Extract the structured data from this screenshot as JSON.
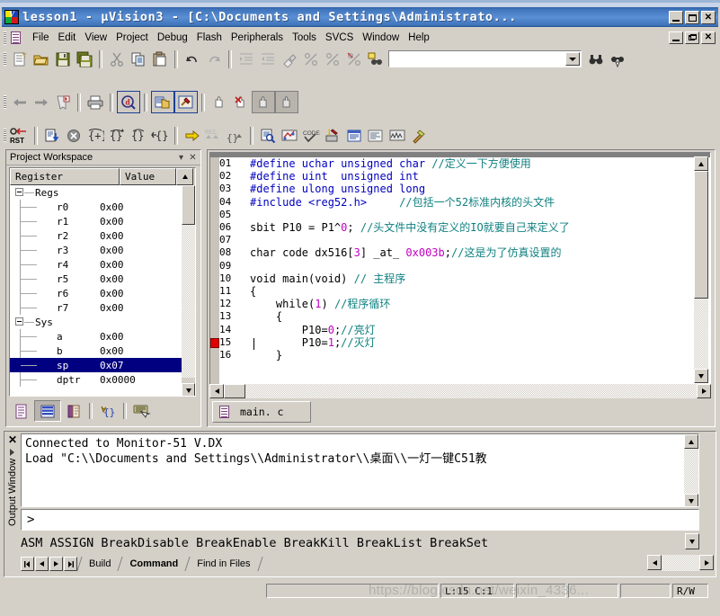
{
  "window": {
    "title": "lesson1  - µVision3 - [C:\\Documents and Settings\\Administrato...",
    "minimize": "–",
    "maximize": "□",
    "close": "✕"
  },
  "mdi": {
    "minimize": "–",
    "restore": "❐",
    "close": "✕"
  },
  "menu": {
    "items": [
      {
        "label": "File"
      },
      {
        "label": "Edit"
      },
      {
        "label": "View"
      },
      {
        "label": "Project"
      },
      {
        "label": "Debug"
      },
      {
        "label": "Flash"
      },
      {
        "label": "Peripherals"
      },
      {
        "label": "Tools"
      },
      {
        "label": "SVCS"
      },
      {
        "label": "Window"
      },
      {
        "label": "Help"
      }
    ]
  },
  "toolbar": {
    "find_combo_value": "",
    "find_combo_placeholder": ""
  },
  "project_workspace": {
    "title": "Project Workspace",
    "collapse_icon": "▾",
    "close_icon": "✕",
    "columns": [
      "Register",
      "Value"
    ],
    "rows": [
      {
        "name": "Regs",
        "value": "",
        "level": 0,
        "group": true,
        "selected": false
      },
      {
        "name": "r0",
        "value": "0x00",
        "level": 2,
        "group": false,
        "selected": false
      },
      {
        "name": "r1",
        "value": "0x00",
        "level": 2,
        "group": false,
        "selected": false
      },
      {
        "name": "r2",
        "value": "0x00",
        "level": 2,
        "group": false,
        "selected": false
      },
      {
        "name": "r3",
        "value": "0x00",
        "level": 2,
        "group": false,
        "selected": false
      },
      {
        "name": "r4",
        "value": "0x00",
        "level": 2,
        "group": false,
        "selected": false
      },
      {
        "name": "r5",
        "value": "0x00",
        "level": 2,
        "group": false,
        "selected": false
      },
      {
        "name": "r6",
        "value": "0x00",
        "level": 2,
        "group": false,
        "selected": false
      },
      {
        "name": "r7",
        "value": "0x00",
        "level": 2,
        "group": false,
        "selected": false
      },
      {
        "name": "Sys",
        "value": "",
        "level": 0,
        "group": true,
        "selected": false
      },
      {
        "name": "a",
        "value": "0x00",
        "level": 2,
        "group": false,
        "selected": false
      },
      {
        "name": "b",
        "value": "0x00",
        "level": 2,
        "group": false,
        "selected": false
      },
      {
        "name": "sp",
        "value": "0x07",
        "level": 2,
        "group": false,
        "selected": true
      },
      {
        "name": "dptr",
        "value": "0x0000",
        "level": 2,
        "group": false,
        "selected": false
      }
    ],
    "tabs": [
      {
        "name": "files-tab",
        "icon": "document-icon"
      },
      {
        "name": "regs-tab",
        "icon": "list-icon",
        "active": true
      },
      {
        "name": "books-tab",
        "icon": "book-icon"
      },
      {
        "name": "funcs-icon",
        "icon": "braces-icon"
      },
      {
        "name": "templates-tab",
        "icon": "keyboard-icon"
      }
    ]
  },
  "editor": {
    "file_tab": "main. c",
    "breakpoint_line": 15,
    "caret_line": 15,
    "lines": [
      {
        "no": "01",
        "segs": [
          {
            "t": "#define uchar unsigned char ",
            "c": "kw"
          },
          {
            "t": "//定义一下方便使用",
            "c": "cmt"
          }
        ]
      },
      {
        "no": "02",
        "segs": [
          {
            "t": "#define uint  unsigned int",
            "c": "kw"
          }
        ]
      },
      {
        "no": "03",
        "segs": [
          {
            "t": "#define ulong unsigned long",
            "c": "kw"
          }
        ]
      },
      {
        "no": "04",
        "segs": [
          {
            "t": "#include <reg52.h>",
            "c": "kw"
          },
          {
            "t": "    ",
            "c": ""
          },
          {
            "t": "//包括一个52标准内核的头文件",
            "c": "cmt"
          }
        ]
      },
      {
        "no": "05",
        "segs": []
      },
      {
        "no": "06",
        "segs": [
          {
            "t": "sbit P10 = P1^",
            "c": ""
          },
          {
            "t": "0",
            "c": "num"
          },
          {
            "t": "; ",
            "c": ""
          },
          {
            "t": "//头文件中没有定义的IO就要自己来定义了",
            "c": "cmt"
          }
        ]
      },
      {
        "no": "07",
        "segs": []
      },
      {
        "no": "08",
        "segs": [
          {
            "t": "char code dx516[",
            "c": ""
          },
          {
            "t": "3",
            "c": "num"
          },
          {
            "t": "] _at_ ",
            "c": ""
          },
          {
            "t": "0x003b",
            "c": "num"
          },
          {
            "t": ";",
            "c": ""
          },
          {
            "t": "//这是为了仿真设置的",
            "c": "cmt"
          }
        ]
      },
      {
        "no": "09",
        "segs": []
      },
      {
        "no": "10",
        "segs": [
          {
            "t": "void main(void) ",
            "c": ""
          },
          {
            "t": "// 主程序",
            "c": "cmt"
          }
        ]
      },
      {
        "no": "11",
        "segs": [
          {
            "t": "{",
            "c": ""
          }
        ]
      },
      {
        "no": "12",
        "segs": [
          {
            "t": "    while(",
            "c": ""
          },
          {
            "t": "1",
            "c": "num"
          },
          {
            "t": ") ",
            "c": ""
          },
          {
            "t": "//程序循环",
            "c": "cmt"
          }
        ]
      },
      {
        "no": "13",
        "segs": [
          {
            "t": "    {",
            "c": ""
          }
        ]
      },
      {
        "no": "14",
        "segs": [
          {
            "t": "        P10=",
            "c": ""
          },
          {
            "t": "0",
            "c": "num"
          },
          {
            "t": ";",
            "c": ""
          },
          {
            "t": "//亮灯",
            "c": "cmt"
          }
        ]
      },
      {
        "no": "15",
        "segs": [
          {
            "t": "        P10=",
            "c": ""
          },
          {
            "t": "1",
            "c": "num"
          },
          {
            "t": ";",
            "c": ""
          },
          {
            "t": "//灭灯",
            "c": "cmt"
          }
        ]
      },
      {
        "no": "16",
        "segs": [
          {
            "t": "    }",
            "c": ""
          }
        ]
      }
    ]
  },
  "output_window": {
    "side_label": "Output Window",
    "close_icon": "✕",
    "log_lines": [
      "Connected to Monitor-51 V.DX",
      "Load \"C:\\\\Documents and Settings\\\\Administrator\\\\桌面\\\\一灯一键C51教"
    ],
    "command_prompt": ">",
    "command_value": "",
    "hint_text": "ASM ASSIGN BreakDisable BreakEnable BreakKill BreakList BreakSet",
    "tabs": [
      {
        "label": "Build",
        "active": false
      },
      {
        "label": "Command",
        "active": true
      },
      {
        "label": "Find in Files",
        "active": false
      }
    ],
    "nav_first": "⏮",
    "nav_prev": "◀",
    "nav_next": "▶",
    "nav_last": "⏭"
  },
  "status_bar": {
    "message": "",
    "line_col": "L:15 C:1",
    "fields": [
      "",
      "",
      "",
      ""
    ],
    "rw_indicator": "R/W"
  },
  "watermark": "https://blog.csdn.net/weixin_4336...",
  "colors": {
    "title_active": "#3f74bb",
    "face": "#d4d0c8",
    "selection": "#000080",
    "comment": "#108080",
    "keyword": "#0000c0",
    "number": "#c000c0",
    "breakpoint": "#e00000"
  }
}
